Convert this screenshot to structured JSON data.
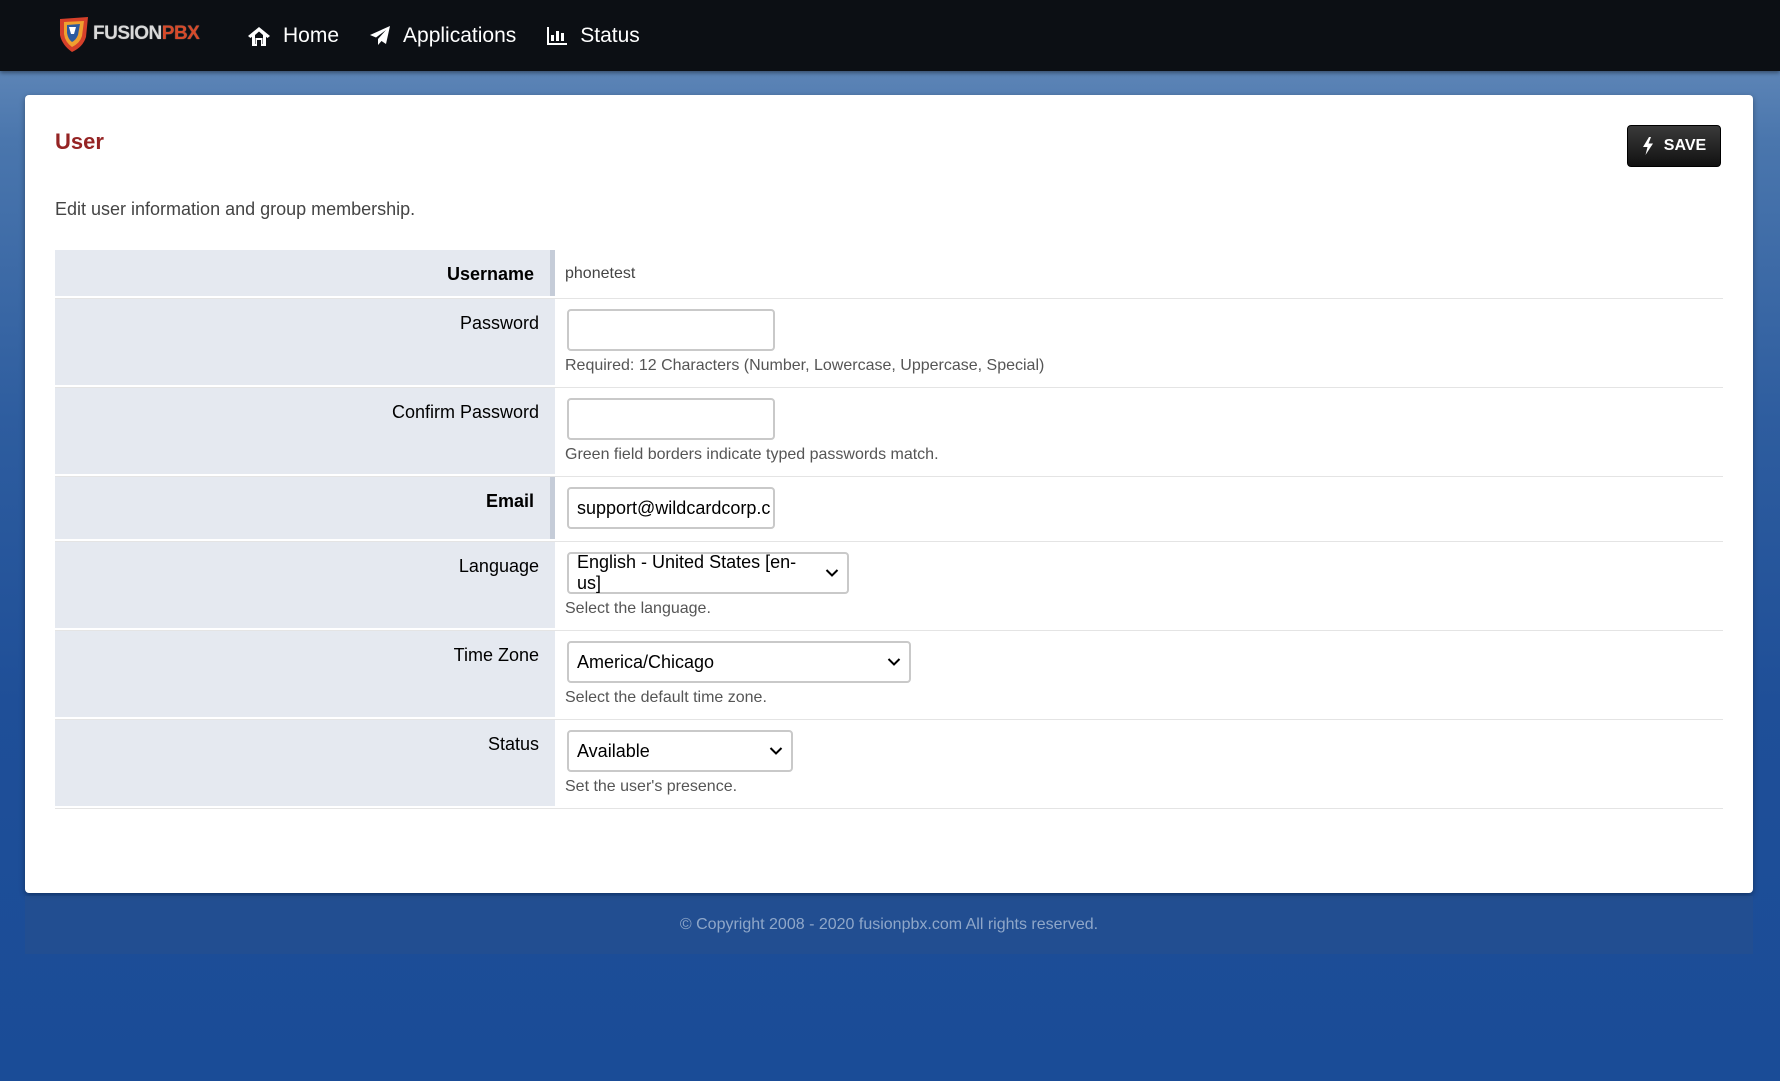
{
  "navbar": {
    "logo_text_main": "FUSION",
    "logo_text_accent": "PBX",
    "items": [
      {
        "label": "Home",
        "icon": "home-icon"
      },
      {
        "label": "Applications",
        "icon": "paper-plane-icon"
      },
      {
        "label": "Status",
        "icon": "bar-chart-icon"
      }
    ]
  },
  "page": {
    "title": "User",
    "save_label": "SAVE",
    "description": "Edit user information and group membership."
  },
  "form": {
    "username": {
      "label": "Username",
      "value": "phonetest"
    },
    "password": {
      "label": "Password",
      "value": "",
      "help": "Required: 12 Characters (Number, Lowercase, Uppercase, Special)"
    },
    "confirm_password": {
      "label": "Confirm Password",
      "value": "",
      "help": "Green field borders indicate typed passwords match."
    },
    "email": {
      "label": "Email",
      "value": "support@wildcardcorp.c"
    },
    "language": {
      "label": "Language",
      "value": "English - United States [en-us]",
      "help": "Select the language."
    },
    "time_zone": {
      "label": "Time Zone",
      "value": "America/Chicago",
      "help": "Select the default time zone."
    },
    "status": {
      "label": "Status",
      "value": "Available",
      "help": "Set the user's presence."
    }
  },
  "footer": {
    "copyright": "© Copyright 2008 - 2020 fusionpbx.com All rights reserved."
  },
  "colors": {
    "navbar_bg": "#0c0f14",
    "title_red": "#952424",
    "label_bg": "#e5e9f0"
  }
}
